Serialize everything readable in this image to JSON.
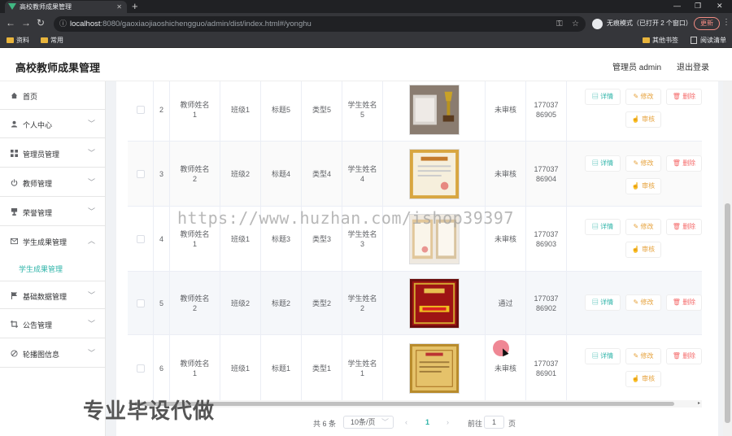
{
  "browser": {
    "tab_title": "高校教师成果管理",
    "new_tab": "+",
    "url_host": "localhost",
    "url_path": ":8080/gaoxiaojiaoshichengguo/admin/dist/index.html#/yonghu",
    "incognito_label": "无痕模式（已打开 2 个窗口）",
    "update_label": "更新",
    "bookmarks": [
      "资料",
      "常用"
    ],
    "bookmarks_right": [
      "其他书签",
      "阅读清单"
    ]
  },
  "header": {
    "title": "高校教师成果管理",
    "admin_label": "管理员 admin",
    "logout": "退出登录"
  },
  "sidebar": {
    "items": [
      {
        "label": "首页",
        "icon": "home-icon"
      },
      {
        "label": "个人中心",
        "icon": "user-icon"
      },
      {
        "label": "管理员管理",
        "icon": "grid-icon"
      },
      {
        "label": "教师管理",
        "icon": "power-icon"
      },
      {
        "label": "荣誉管理",
        "icon": "trophy-icon"
      },
      {
        "label": "学生成果管理",
        "icon": "mail-icon"
      },
      {
        "label": "基础数据管理",
        "icon": "flag-icon"
      },
      {
        "label": "公告管理",
        "icon": "crop-icon"
      },
      {
        "label": "轮播图信息",
        "icon": "tool-icon"
      }
    ],
    "sub_item": "学生成果管理"
  },
  "table": {
    "rows": [
      {
        "no": "2",
        "name": "教师姓名1",
        "class": "班级1",
        "title": "标题5",
        "type": "类型5",
        "student": "学生姓名5",
        "status": "未审核",
        "phone": "17703786905",
        "has_audit": true
      },
      {
        "no": "3",
        "name": "教师姓名2",
        "class": "班级2",
        "title": "标题4",
        "type": "类型4",
        "student": "学生姓名4",
        "status": "未审核",
        "phone": "17703786904",
        "has_audit": true
      },
      {
        "no": "4",
        "name": "教师姓名1",
        "class": "班级1",
        "title": "标题3",
        "type": "类型3",
        "student": "学生姓名3",
        "status": "未审核",
        "phone": "17703786903",
        "has_audit": true
      },
      {
        "no": "5",
        "name": "教师姓名2",
        "class": "班级2",
        "title": "标题2",
        "type": "类型2",
        "student": "学生姓名2",
        "status": "通过",
        "phone": "17703786902",
        "has_audit": false
      },
      {
        "no": "6",
        "name": "教师姓名1",
        "class": "班级1",
        "title": "标题1",
        "type": "类型1",
        "student": "学生姓名1",
        "status": "未审核",
        "phone": "17703786901",
        "has_audit": true
      }
    ],
    "actions": {
      "detail": "详情",
      "edit": "修改",
      "delete": "删除",
      "audit": "审核"
    }
  },
  "pagination": {
    "total": "共 6 条",
    "page_size": "10条/页",
    "current": "1",
    "goto_label": "前往",
    "goto_value": "1",
    "page_suffix": "页"
  },
  "overlays": {
    "watermark_url": "https://www.huzhan.com/ishop39397",
    "watermark_text": "专业毕设代做"
  },
  "colors": {
    "accent": "#2fb4a9",
    "warning": "#e6a23c",
    "danger": "#f56c6c"
  }
}
